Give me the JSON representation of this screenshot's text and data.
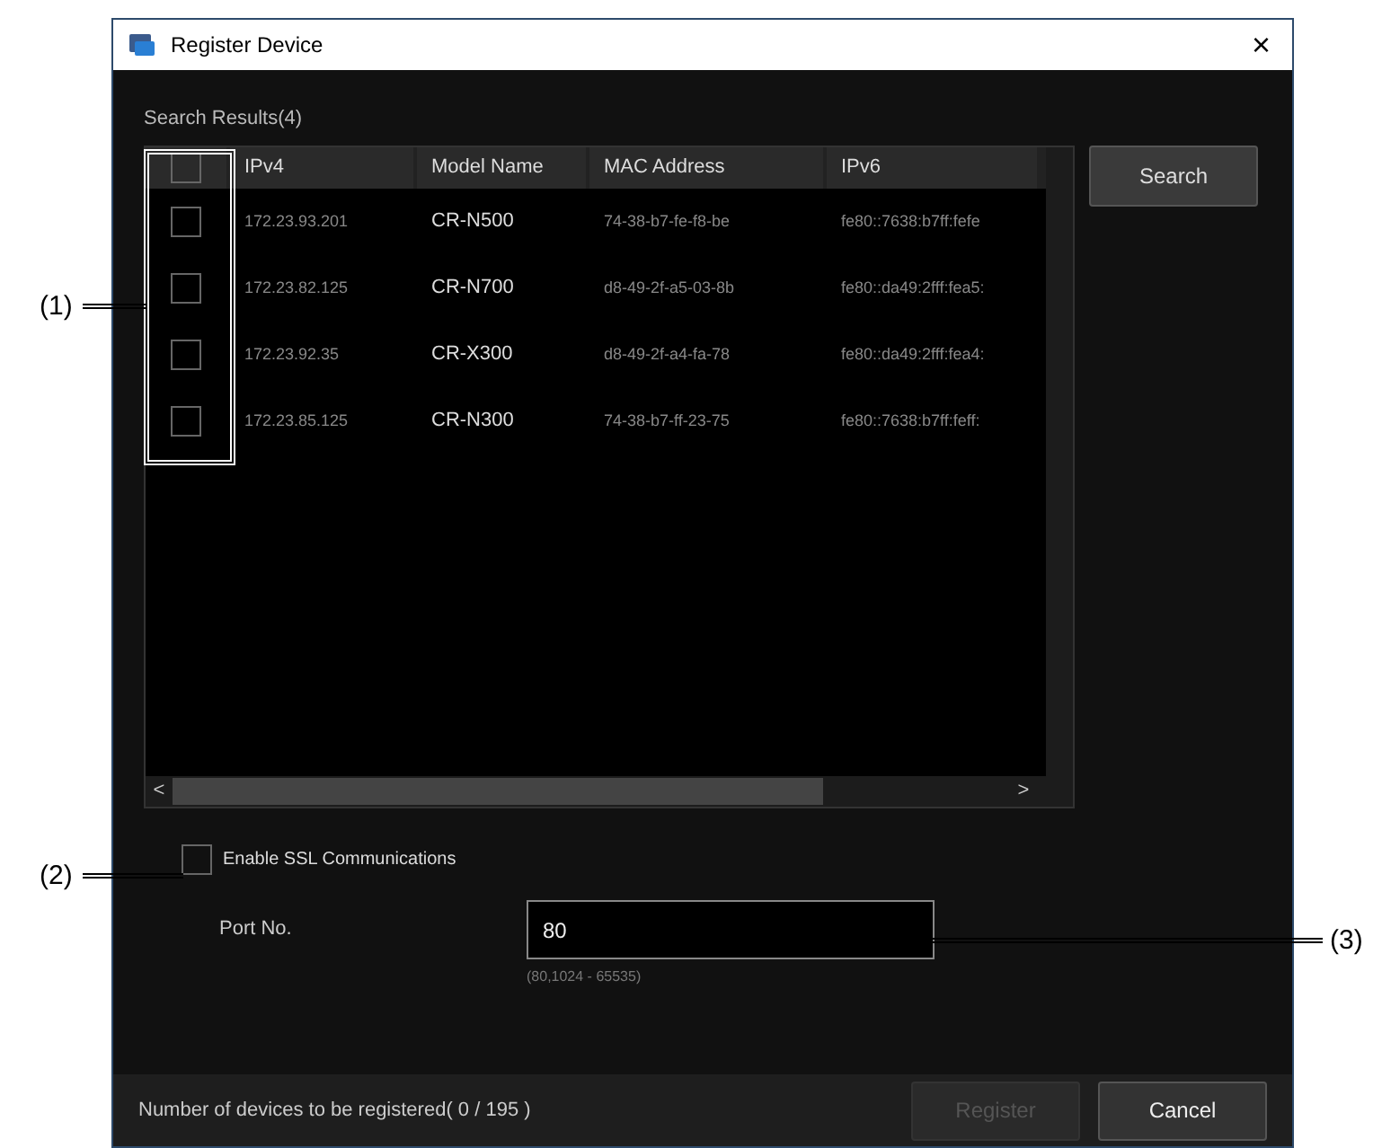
{
  "window": {
    "title": "Register Device",
    "close": "×"
  },
  "search_results_label": "Search Results(4)",
  "table": {
    "header_checked": false,
    "columns": [
      "IPv4",
      "Model Name",
      "MAC Address",
      "IPv6"
    ],
    "rows": [
      {
        "selected": false,
        "cells": [
          "172.23.93.201",
          "CR-N500",
          "74-38-b7-fe-f8-be",
          "fe80::7638:b7ff:fefe"
        ]
      },
      {
        "selected": false,
        "cells": [
          "172.23.82.125",
          "CR-N700",
          "d8-49-2f-a5-03-8b",
          "fe80::da49:2fff:fea5:"
        ]
      },
      {
        "selected": false,
        "cells": [
          "172.23.92.35",
          "CR-X300",
          "d8-49-2f-a4-fa-78",
          "fe80::da49:2fff:fea4:"
        ]
      },
      {
        "selected": false,
        "cells": [
          "172.23.85.125",
          "CR-N300",
          "74-38-b7-ff-23-75",
          "fe80::7638:b7ff:feff:"
        ]
      }
    ],
    "scroll_left": "<",
    "scroll_right": ">"
  },
  "search_button": "Search",
  "ssl": {
    "label": "Enable SSL Communications",
    "checked": false
  },
  "port": {
    "label": "Port No.",
    "value": "80",
    "hint": "(80,1024 - 65535)"
  },
  "footer_text": "Number of devices to be registered( 0 / 195 )",
  "buttons": [
    {
      "label": "Register",
      "disabled": true
    },
    {
      "label": "Cancel",
      "disabled": false
    }
  ],
  "callouts": [
    {
      "label": "(1)"
    },
    {
      "label": "(2)"
    },
    {
      "label": "(3)"
    }
  ]
}
